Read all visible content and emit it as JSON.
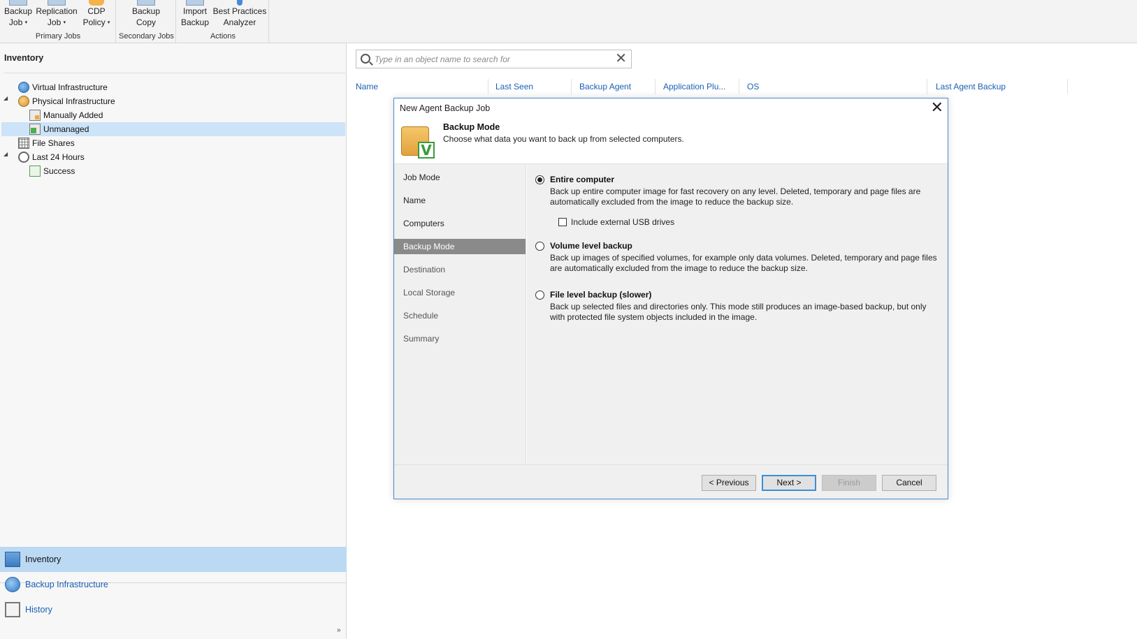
{
  "ribbon": {
    "groups": [
      {
        "caption": "Primary Jobs",
        "buttons": [
          {
            "line1": "Backup",
            "line2": "Job",
            "dropdown": true
          },
          {
            "line1": "Replication",
            "line2": "Job",
            "dropdown": true
          },
          {
            "line1": "CDP",
            "line2": "Policy",
            "dropdown": true
          }
        ]
      },
      {
        "caption": "Secondary Jobs",
        "buttons": [
          {
            "line1": "Backup",
            "line2": "Copy",
            "dropdown": false
          }
        ]
      },
      {
        "caption": "Actions",
        "buttons": [
          {
            "line1": "Import",
            "line2": "Backup",
            "dropdown": false
          },
          {
            "line1": "Best Practices",
            "line2": "Analyzer",
            "dropdown": false
          }
        ]
      }
    ],
    "caret": "▾"
  },
  "inventory": {
    "title": "Inventory",
    "tree": [
      {
        "label": "Virtual Infrastructure",
        "icon": "globe-icon"
      },
      {
        "label": "Physical Infrastructure",
        "icon": "globe-icon",
        "expanded": true
      },
      {
        "label": "Manually Added",
        "icon": "server-icon"
      },
      {
        "label": "Unmanaged",
        "icon": "server-check-icon",
        "selected": true
      },
      {
        "label": "File Shares",
        "icon": "file-share-icon"
      },
      {
        "label": "Last 24 Hours",
        "icon": "clock-icon",
        "expanded": true
      },
      {
        "label": "Success",
        "icon": "success-icon"
      }
    ],
    "expander_glyph": "◢"
  },
  "nav": {
    "items": [
      {
        "label": "Inventory",
        "active": true
      },
      {
        "label": "Backup Infrastructure",
        "active": false
      },
      {
        "label": "History",
        "active": false
      }
    ],
    "collapse_glyph": "»"
  },
  "search": {
    "placeholder": "Type in an object name to search for",
    "clear_glyph": "✕"
  },
  "columns": [
    "Name",
    "Last Seen",
    "Backup Agent",
    "Application Plu...",
    "OS",
    "Last Agent Backup"
  ],
  "dialog": {
    "title": "New Agent Backup Job",
    "close_glyph": "✕",
    "header_title": "Backup Mode",
    "header_desc": "Choose what data you want to back up from selected computers.",
    "header_icon_mark": "V",
    "steps": [
      "Job Mode",
      "Name",
      "Computers",
      "Backup Mode",
      "Destination",
      "Local Storage",
      "Schedule",
      "Summary"
    ],
    "active_step": "Backup Mode",
    "options": [
      {
        "title": "Entire computer",
        "desc": "Back up entire computer image for fast recovery on any level. Deleted, temporary and page files are automatically excluded from the image to reduce the backup size.",
        "selected": true
      },
      {
        "title": "Volume level backup",
        "desc": "Back up images of specified volumes, for example only data volumes. Deleted, temporary and page files are automatically excluded from the image to reduce the backup size.",
        "selected": false
      },
      {
        "title": "File level backup (slower)",
        "desc": "Back up selected files and directories only. This mode still produces an image-based backup, but only with protected file system objects included in the image.",
        "selected": false
      }
    ],
    "usb_checkbox": {
      "label": "Include external USB drives",
      "checked": false
    },
    "buttons": {
      "previous": "< Previous",
      "next": "Next >",
      "finish": "Finish",
      "cancel": "Cancel"
    }
  }
}
